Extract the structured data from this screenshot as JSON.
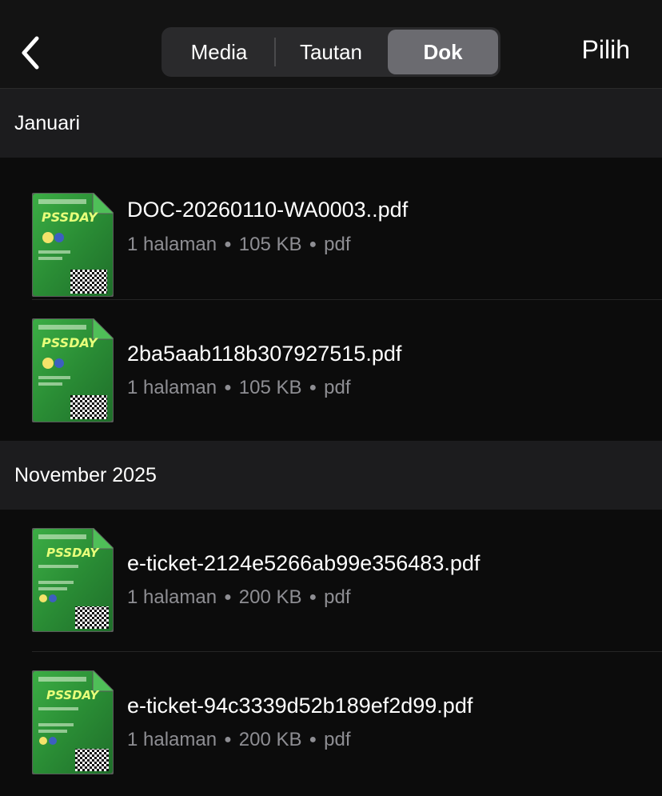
{
  "header": {
    "tabs": [
      {
        "label": "Media",
        "active": false
      },
      {
        "label": "Tautan",
        "active": false
      },
      {
        "label": "Dok",
        "active": true
      }
    ],
    "select_label": "Pilih"
  },
  "sections": [
    {
      "title": "Januari",
      "items": [
        {
          "filename": "DOC-20260110-WA0003..pdf",
          "pages": "1 halaman",
          "size": "105 KB",
          "type": "pdf",
          "thumb_text": "PSSDAY"
        },
        {
          "filename": "2ba5aab118b307927515.pdf",
          "pages": "1 halaman",
          "size": "105 KB",
          "type": "pdf",
          "thumb_text": "PSSDAY"
        }
      ]
    },
    {
      "title": "November 2025",
      "items": [
        {
          "filename": "e-ticket-2124e5266ab99e356483.pdf",
          "pages": "1 halaman",
          "size": "200 KB",
          "type": "pdf",
          "thumb_text": "PSSDAY"
        },
        {
          "filename": "e-ticket-94c3339d52b189ef2d99.pdf",
          "pages": "1 halaman",
          "size": "200 KB",
          "type": "pdf",
          "thumb_text": "PSSDAY"
        }
      ]
    }
  ],
  "colors": {
    "background": "#0c0c0c",
    "section_header": "#1c1c1e",
    "segment_active": "#6b6b70",
    "meta_text": "#8e8e93",
    "thumb_green": "#2f9a3a"
  },
  "icons": {
    "back": "chevron-left-icon",
    "thumbnail": "pdf-thumbnail"
  }
}
